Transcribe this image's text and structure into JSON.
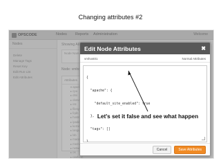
{
  "slide": {
    "title": "Changing attributes #2"
  },
  "background_app": {
    "logo": "OPSCODE",
    "nav_tabs": [
      "Nodes",
      "Reports",
      "Administration"
    ],
    "user": "Welcome",
    "sidebar": {
      "heading": "Nodes",
      "items": [
        "Delete",
        "Manage Tags",
        "Reset Key",
        "Edit Run List",
        "Edit Attributes"
      ]
    },
    "main": {
      "heading": "Showing All Nodes",
      "box_label": "Node Name",
      "node_label": "Node: vmhost01",
      "attr_tab": "Attributes",
      "tree_items": [
        "apache",
        "cpu",
        "dmi",
        "domain",
        "etc",
        "filesystem",
        "fqdn",
        "hostname",
        "ipaddress",
        "kernel",
        "languages",
        "lsb",
        "macaddress",
        "memory",
        "network",
        "os",
        "platform"
      ]
    }
  },
  "modal": {
    "title": "Edit Node Attributes",
    "close_glyph": "✖",
    "subrow_left": "vmhost01",
    "subrow_right": "Normal Attributes",
    "editor_lines": [
      "{",
      "  \"apache\": {",
      "    \"default_site_enabled\": true",
      "  },",
      "  \"tags\": []",
      "}"
    ],
    "cancel_label": "Cancel",
    "save_label": "Save Attributes"
  },
  "annotation": {
    "text": "Let's set it false and see what happen"
  }
}
